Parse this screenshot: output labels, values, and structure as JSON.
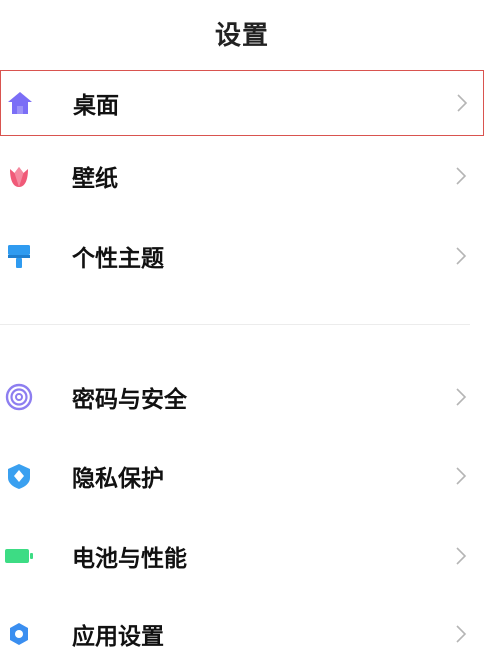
{
  "header": {
    "title": "设置"
  },
  "sections": [
    {
      "items": [
        {
          "label": "桌面",
          "icon": "home-icon",
          "color": "#7b6ef6",
          "highlighted": true
        },
        {
          "label": "壁纸",
          "icon": "tulip-icon",
          "color": "#f05a78"
        },
        {
          "label": "个性主题",
          "icon": "paintbrush-icon",
          "color": "#2f9bf0"
        }
      ]
    },
    {
      "items": [
        {
          "label": "密码与安全",
          "icon": "fingerprint-icon",
          "color": "#8d7ef0"
        },
        {
          "label": "隐私保护",
          "icon": "shield-icon",
          "color": "#3aa0f0"
        },
        {
          "label": "电池与性能",
          "icon": "battery-icon",
          "color": "#3ddc84"
        },
        {
          "label": "应用设置",
          "icon": "gear-icon",
          "color": "#3a8ef0"
        }
      ]
    }
  ],
  "colors": {
    "highlight_border": "#d9534f",
    "chevron": "#b5b5b5",
    "divider": "#ececec"
  }
}
